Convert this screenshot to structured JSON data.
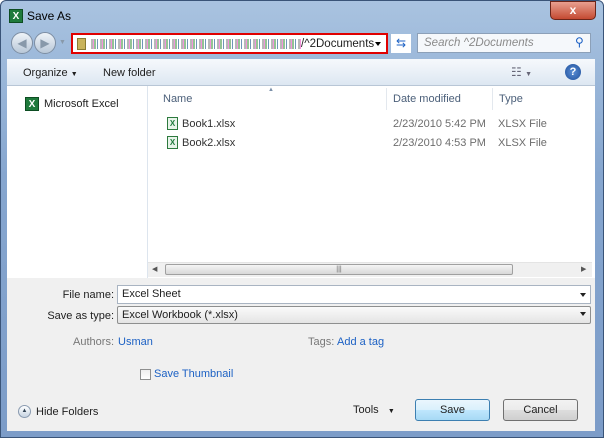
{
  "window": {
    "title": "Save As",
    "close_label": "x"
  },
  "nav": {
    "address_suffix": "/^2Documents",
    "search_placeholder": "Search ^2Documents"
  },
  "toolbar": {
    "organize": "Organize",
    "new_folder": "New folder"
  },
  "sidebar": {
    "items": [
      {
        "label": "Microsoft Excel"
      }
    ]
  },
  "columns": {
    "name": "Name",
    "date": "Date modified",
    "type": "Type"
  },
  "files": [
    {
      "name": "Book1.xlsx",
      "date": "2/23/2010 5:42 PM",
      "type": "XLSX File"
    },
    {
      "name": "Book2.xlsx",
      "date": "2/23/2010 4:53 PM",
      "type": "XLSX File"
    }
  ],
  "form": {
    "file_name_label": "File name:",
    "file_name_value": "Excel Sheet",
    "type_label": "Save as type:",
    "type_value": "Excel Workbook (*.xlsx)",
    "authors_label": "Authors:",
    "authors_value": "Usman",
    "tags_label": "Tags:",
    "tags_value": "Add a tag",
    "thumbnail_label": "Save Thumbnail",
    "thumbnail_checked": false
  },
  "footer": {
    "hide_folders": "Hide Folders",
    "tools": "Tools",
    "save": "Save",
    "cancel": "Cancel"
  }
}
